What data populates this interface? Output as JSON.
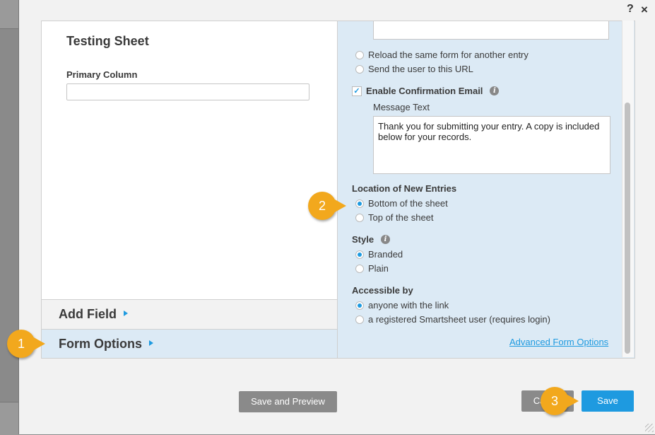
{
  "dialog": {
    "help_label": "?",
    "close_label": "×"
  },
  "left_panel": {
    "sheet_title": "Testing Sheet",
    "primary_column_label": "Primary Column",
    "primary_column_value": "",
    "accordion": [
      {
        "label": "Add Field",
        "active": false
      },
      {
        "label": "Form Options",
        "active": true
      }
    ]
  },
  "right_panel": {
    "redirect_url_value": "",
    "after_submit_options": [
      {
        "label": "Reload the same form for another entry",
        "selected": false
      },
      {
        "label": "Send the user to this URL",
        "selected": false
      }
    ],
    "confirmation_email": {
      "label": "Enable Confirmation Email",
      "checked": true,
      "check_glyph": "✓",
      "info_glyph": "i",
      "message_label": "Message Text",
      "message_value": "Thank you for submitting your entry. A copy is included below for your records."
    },
    "location": {
      "label": "Location of New Entries",
      "options": [
        {
          "label": "Bottom of the sheet",
          "selected": true
        },
        {
          "label": "Top of the sheet",
          "selected": false
        }
      ]
    },
    "style": {
      "label": "Style",
      "info_glyph": "i",
      "options": [
        {
          "label": "Branded",
          "selected": true
        },
        {
          "label": "Plain",
          "selected": false
        }
      ]
    },
    "accessible_by": {
      "label": "Accessible by",
      "options": [
        {
          "label": "anyone with the link",
          "selected": true
        },
        {
          "label": "a registered Smartsheet user (requires login)",
          "selected": false
        }
      ]
    },
    "advanced_link": "Advanced Form Options"
  },
  "footer": {
    "save_preview_label": "Save and Preview",
    "cancel_label": "Cancel",
    "save_label": "Save"
  },
  "callouts": [
    "1",
    "2",
    "3"
  ],
  "colors": {
    "accent": "#1e9ae0",
    "callout": "#f2a81d",
    "panel_bg": "#dceaf5",
    "secondary_button": "#8a8a8a"
  }
}
